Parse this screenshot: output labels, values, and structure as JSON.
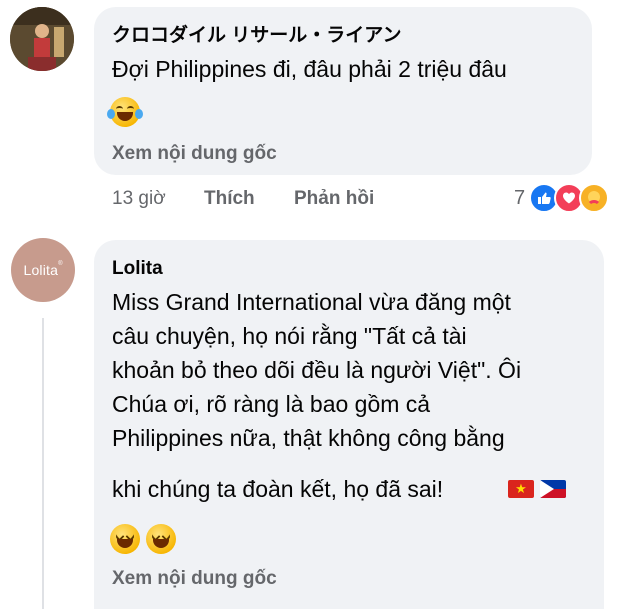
{
  "comment1": {
    "author": "クロコダイル リサール・ライアン",
    "text": "Đợi Philippines đi, đâu phải 2 triệu đâu",
    "see_original": "Xem nội dung gốc",
    "time": "13 giờ",
    "like_label": "Thích",
    "reply_label": "Phản hồi",
    "reaction_count": "7",
    "reactions": [
      "like-icon",
      "love-icon",
      "care-icon"
    ],
    "emoji": [
      "laughing-tears-emoji"
    ]
  },
  "comment2": {
    "author": "Lolita",
    "avatar_text": "Lolita",
    "text_lines": [
      "Miss Grand International vừa đăng một",
      "câu chuyện, họ nói rằng \"Tất cả tài",
      "khoản bỏ theo dõi đều là người Việt\". Ôi",
      "Chúa ơi, rõ ràng là bao gồm cả",
      "Philippines nữa, thật không công bằng",
      "khi chúng ta đoàn kết, họ đã sai!"
    ],
    "flags": [
      "vietnam-flag",
      "philippines-flag"
    ],
    "emoji": [
      "grinning-squint-emoji",
      "grinning-squint-emoji"
    ],
    "see_original": "Xem nội dung gốc"
  },
  "colors": {
    "bubble": "#f0f2f5",
    "secondary_text": "#65676b",
    "like_blue": "#1877f2",
    "love_red": "#f33e58"
  }
}
